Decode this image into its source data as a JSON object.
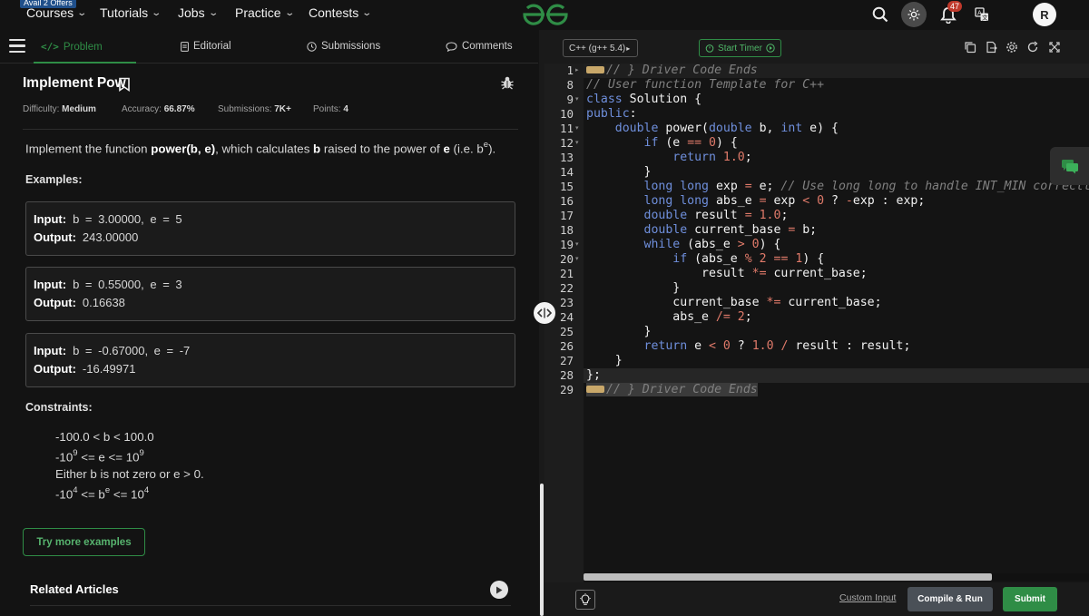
{
  "nav": {
    "offer_badge": "Avail 2 Offers",
    "items": [
      "Courses",
      "Tutorials",
      "Jobs",
      "Practice",
      "Contests"
    ],
    "notification_count": "47",
    "avatar_letter": "R",
    "brand_color": "#2f8d46"
  },
  "tabs": [
    "Problem",
    "Editorial",
    "Submissions",
    "Comments"
  ],
  "problem": {
    "title": "Implement Pow",
    "difficulty_label": "Difficulty:",
    "difficulty": "Medium",
    "accuracy_label": "Accuracy:",
    "accuracy": "66.87%",
    "submissions_label": "Submissions:",
    "submissions": "7K+",
    "points_label": "Points:",
    "points": "4",
    "statement_pre": "Implement the function ",
    "statement_fn": "power(b, e)",
    "statement_mid": ", which calculates ",
    "statement_b": "b",
    "statement_mid2": " raised to the power of ",
    "statement_e": "e",
    "statement_tail": " (i.e. b",
    "statement_sup": "e",
    "statement_end": ").",
    "examples_heading": "Examples:",
    "examples": [
      {
        "input_label": "Input:",
        "input": "b = 3.00000, e = 5",
        "output_label": "Output:",
        "output": "243.00000"
      },
      {
        "input_label": "Input:",
        "input": "b = 0.55000, e = 3",
        "output_label": "Output:",
        "output": "0.16638"
      },
      {
        "input_label": "Input:",
        "input": "b = -0.67000, e = -7",
        "output_label": "Output:",
        "output": "-16.49971"
      }
    ],
    "constraints_heading": "Constraints:",
    "constraints": [
      {
        "a": "-100.0 < b < 100.0"
      },
      {
        "a": "-10",
        "s1": "9",
        "b": " <= e <= 10",
        "s2": "9"
      },
      {
        "a": "Either b is not zero or e > 0."
      },
      {
        "a": "-10",
        "s1": "4",
        "b": " <= b",
        "s2": "e",
        "c": " <= 10",
        "s3": "4"
      }
    ],
    "try_more": "Try more examples",
    "related": "Related Articles"
  },
  "editor": {
    "language": "C++ (g++ 5.4)",
    "timer": "Start Timer",
    "line_numbers": [
      "1",
      "8",
      "9",
      "10",
      "11",
      "12",
      "13",
      "14",
      "15",
      "16",
      "17",
      "18",
      "19",
      "20",
      "21",
      "22",
      "23",
      "24",
      "25",
      "26",
      "27",
      "28",
      "29"
    ],
    "lines": [
      "// } Driver Code Ends",
      "// User function Template for C++",
      "class Solution {",
      "public:",
      "    double power(double b, int e) {",
      "        if (e == 0) {",
      "            return 1.0;",
      "        }",
      "        long long exp = e; // Use long long to handle INT_MIN correctly when ca",
      "        long long abs_e = exp < 0 ? -exp : exp;",
      "        double result = 1.0;",
      "        double current_base = b;",
      "        while (abs_e > 0) {",
      "            if (abs_e % 2 == 1) {",
      "                result *= current_base;",
      "            }",
      "            current_base *= current_base;",
      "            abs_e /= 2;",
      "        }",
      "        return e < 0 ? 1.0 / result : result;",
      "    }",
      "};",
      "// } Driver Code Ends"
    ],
    "custom_input": "Custom Input",
    "compile": "Compile & Run",
    "submit": "Submit"
  }
}
